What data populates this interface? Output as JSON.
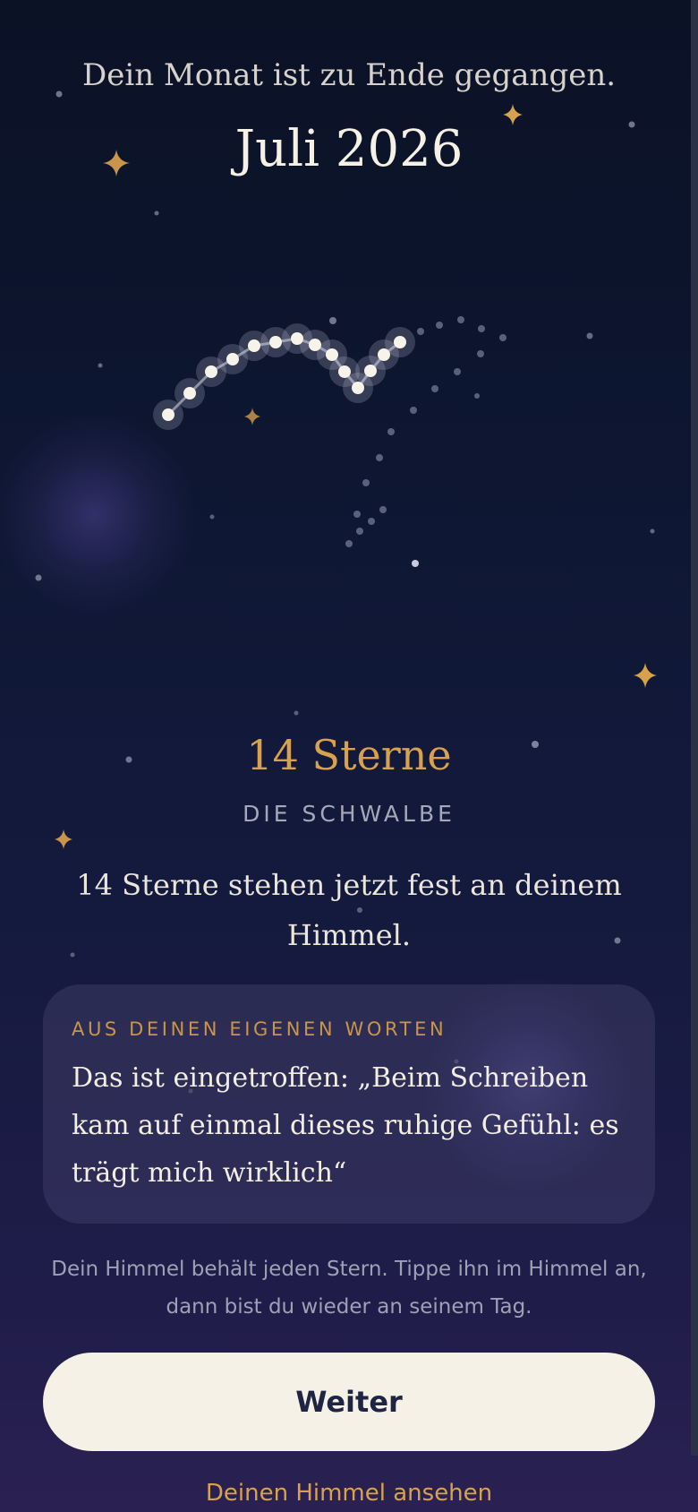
{
  "header": {
    "subtitle": "Dein Monat ist zu Ende gegangen.",
    "month": "Juli 2026"
  },
  "result": {
    "star_count": "14 Sterne",
    "constellation_name": "DIE SCHWALBE",
    "message": "14 Sterne stehen jetzt fest an deinem Himmel."
  },
  "quote_card": {
    "label": "AUS DEINEN EIGENEN WORTEN",
    "text": "Das ist eingetroffen: „Beim Schreiben kam auf einmal dieses ruhige Gefühl: es trägt mich wirklich“"
  },
  "hint": "Dein Himmel behält jeden Stern. Tippe ihn im Himmel an, dann bist du wieder an seinem Tag.",
  "actions": {
    "continue_label": "Weiter",
    "view_sky_label": "Deinen Himmel ansehen"
  },
  "colors": {
    "accent_gold": "#d8a24c",
    "background_top": "#0b1226",
    "background_bottom": "#2a2152",
    "button_background": "#f6f1e6",
    "button_text": "#1d2444"
  },
  "icons": {
    "sparkle": "four-point-star-icon",
    "constellation_star": "star-dot-icon"
  }
}
